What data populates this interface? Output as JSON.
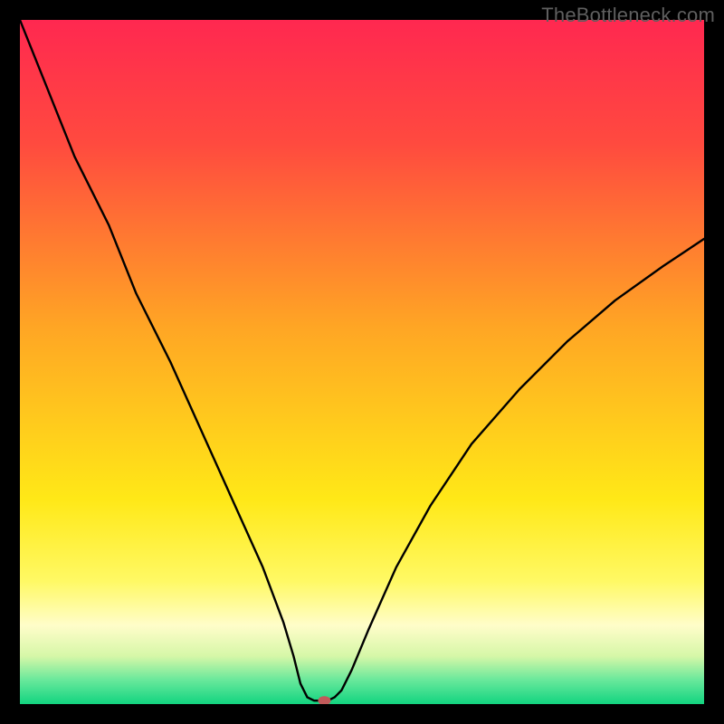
{
  "watermark": "TheBottleneck.com",
  "chart_data": {
    "type": "line",
    "title": "",
    "xlabel": "",
    "ylabel": "",
    "xlim": [
      0,
      100
    ],
    "ylim": [
      0,
      100
    ],
    "background_gradient": {
      "stops": [
        {
          "offset": 0.0,
          "color": "#ff2850"
        },
        {
          "offset": 0.18,
          "color": "#ff4a3f"
        },
        {
          "offset": 0.45,
          "color": "#ffa624"
        },
        {
          "offset": 0.7,
          "color": "#ffe817"
        },
        {
          "offset": 0.82,
          "color": "#fff964"
        },
        {
          "offset": 0.885,
          "color": "#fffdc9"
        },
        {
          "offset": 0.93,
          "color": "#d6f7a8"
        },
        {
          "offset": 0.965,
          "color": "#68e89b"
        },
        {
          "offset": 1.0,
          "color": "#12d480"
        }
      ]
    },
    "curve_points": [
      {
        "x": 0.0,
        "y": 100.0
      },
      {
        "x": 4.0,
        "y": 90.0
      },
      {
        "x": 8.0,
        "y": 80.0
      },
      {
        "x": 13.0,
        "y": 70.0
      },
      {
        "x": 17.0,
        "y": 60.0
      },
      {
        "x": 22.0,
        "y": 50.0
      },
      {
        "x": 26.5,
        "y": 40.0
      },
      {
        "x": 31.0,
        "y": 30.0
      },
      {
        "x": 35.5,
        "y": 20.0
      },
      {
        "x": 38.5,
        "y": 12.0
      },
      {
        "x": 40.0,
        "y": 7.0
      },
      {
        "x": 41.0,
        "y": 3.0
      },
      {
        "x": 42.0,
        "y": 1.0
      },
      {
        "x": 43.0,
        "y": 0.5
      },
      {
        "x": 44.0,
        "y": 0.5
      },
      {
        "x": 45.0,
        "y": 0.5
      },
      {
        "x": 46.0,
        "y": 1.0
      },
      {
        "x": 47.0,
        "y": 2.0
      },
      {
        "x": 48.5,
        "y": 5.0
      },
      {
        "x": 51.0,
        "y": 11.0
      },
      {
        "x": 55.0,
        "y": 20.0
      },
      {
        "x": 60.0,
        "y": 29.0
      },
      {
        "x": 66.0,
        "y": 38.0
      },
      {
        "x": 73.0,
        "y": 46.0
      },
      {
        "x": 80.0,
        "y": 53.0
      },
      {
        "x": 87.0,
        "y": 59.0
      },
      {
        "x": 94.0,
        "y": 64.0
      },
      {
        "x": 100.0,
        "y": 68.0
      }
    ],
    "marker": {
      "x": 44.5,
      "y": 0.5,
      "color": "#c15a5a",
      "rx": 7,
      "ry": 5
    }
  }
}
